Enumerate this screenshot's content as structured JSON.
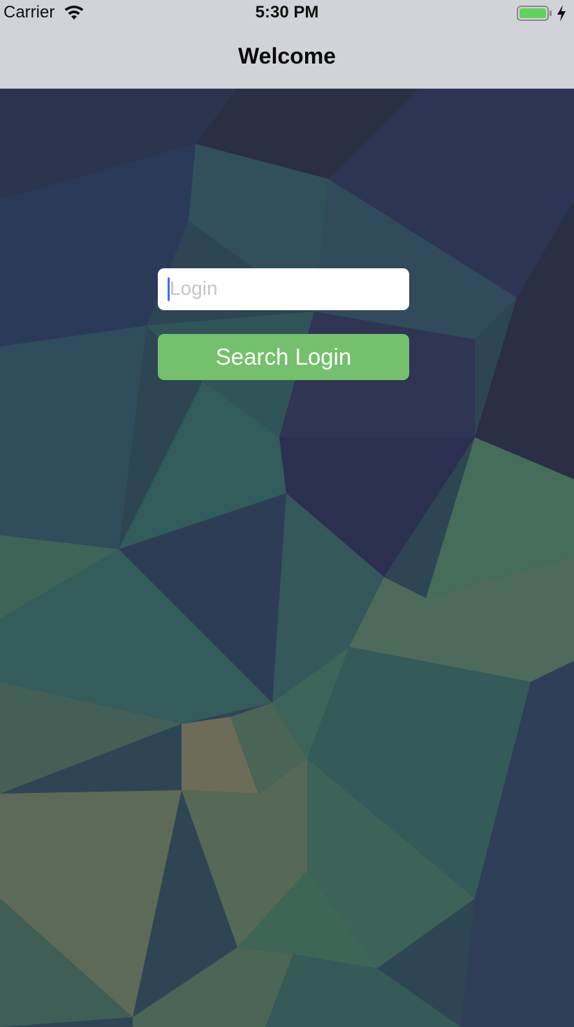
{
  "status_bar": {
    "carrier": "Carrier",
    "time": "5:30 PM",
    "icons": [
      "wifi-icon",
      "battery-icon",
      "charging-bolt-icon"
    ]
  },
  "nav": {
    "title": "Welcome"
  },
  "form": {
    "login_input": {
      "value": "",
      "placeholder": "Login"
    },
    "search_button_label": "Search Login"
  },
  "colors": {
    "nav_bar": "#d1d3d8",
    "button": "#74c06c",
    "caret": "#3c6cf0",
    "battery": "#5fd35b"
  }
}
